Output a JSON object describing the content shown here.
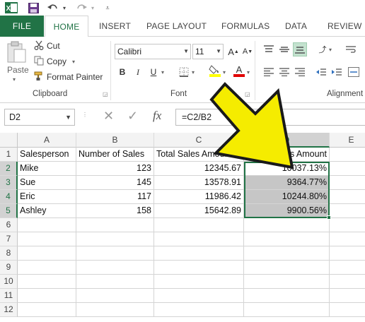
{
  "qat": {
    "excel_icon": "excel-logo-icon",
    "save_icon": "save-icon",
    "undo_icon": "undo-icon",
    "redo_icon": "redo-icon",
    "customize_icon": "customize-qat-icon"
  },
  "tabs": {
    "file": "FILE",
    "home": "HOME",
    "insert": "INSERT",
    "page_layout": "PAGE LAYOUT",
    "formulas": "FORMULAS",
    "data": "DATA",
    "review": "REVIEW"
  },
  "ribbon": {
    "clipboard": {
      "paste": "Paste",
      "cut": "Cut",
      "copy": "Copy",
      "format_painter": "Format Painter",
      "label": "Clipboard"
    },
    "font": {
      "family": "Calibri",
      "size": "11",
      "bold": "B",
      "italic": "I",
      "underline": "U",
      "font_color": "A",
      "label": "Font"
    },
    "alignment": {
      "label": "Alignment"
    }
  },
  "formula_bar": {
    "name_box": "D2",
    "fx": "fx",
    "formula": "=C2/B2"
  },
  "sheet": {
    "columns": [
      "A",
      "B",
      "C",
      "D",
      "E"
    ],
    "rows": [
      "1",
      "2",
      "3",
      "4",
      "5",
      "6",
      "7",
      "8",
      "9",
      "10",
      "11",
      "12"
    ],
    "headers": {
      "a": "Salesperson",
      "b": "Number of Sales",
      "c": "Total Sales Amount",
      "d": "Sales Amount"
    },
    "data": [
      {
        "a": "Mike",
        "b": "123",
        "c": "12345.67",
        "d": "10037.13%"
      },
      {
        "a": "Sue",
        "b": "145",
        "c": "13578.91",
        "d": "9364.77%"
      },
      {
        "a": "Eric",
        "b": "117",
        "c": "11986.42",
        "d": "10244.80%"
      },
      {
        "a": "Ashley",
        "b": "158",
        "c": "15642.89",
        "d": "9900.56%"
      }
    ],
    "selected_range": "D2:D5"
  },
  "colors": {
    "accent": "#217346",
    "arrow_fill": "#f5ec00",
    "arrow_stroke": "#1a1a1a",
    "selection_fill": "#c6c6c6"
  }
}
